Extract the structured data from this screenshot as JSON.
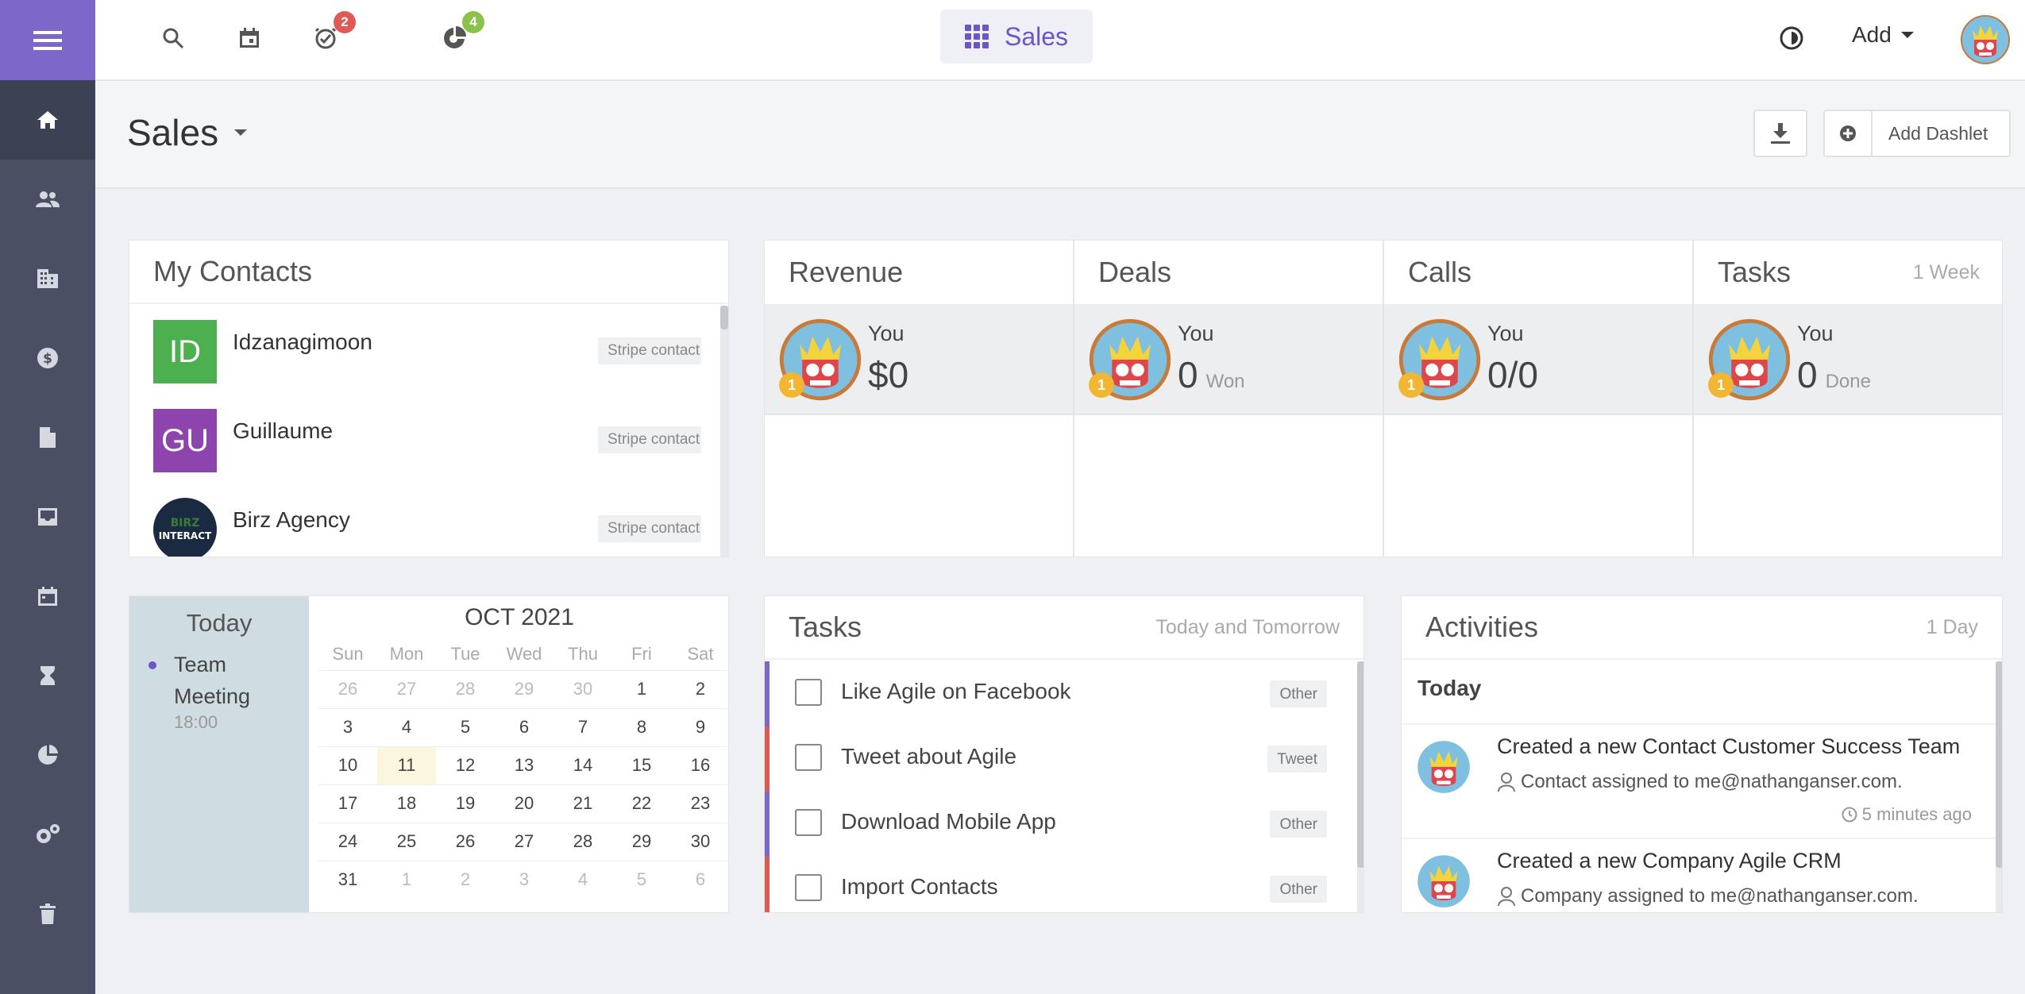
{
  "topbar": {
    "badges": {
      "tasks": "2",
      "goals": "4"
    },
    "dashboard_label": "Sales",
    "add_label": "Add"
  },
  "sidebar": {
    "items": [
      "home-icon",
      "contacts-icon",
      "companies-icon",
      "deals-icon",
      "documents-icon",
      "inbox-icon",
      "calendar-icon",
      "hourglass-icon",
      "reports-icon",
      "settings-icon",
      "trash-icon"
    ]
  },
  "page": {
    "title": "Sales",
    "add_dashlet_label": "Add Dashlet"
  },
  "contacts": {
    "title": "My Contacts",
    "items": [
      {
        "initials": "ID",
        "name": "Idzanagimoon",
        "tag": "Stripe contact",
        "color": "#4caf50"
      },
      {
        "initials": "GU",
        "name": "Guillaume",
        "tag": "Stripe contact",
        "color": "#8e44ad"
      },
      {
        "initials": "",
        "name": "Birz Agency",
        "tag": "Stripe contact",
        "color": "#1a2a40",
        "logo_text": "BIRZ INTERACT"
      }
    ]
  },
  "stats": {
    "subtitle": "1 Week",
    "rank": "1",
    "who": "You",
    "items": [
      {
        "title": "Revenue",
        "value": "$0",
        "unit": ""
      },
      {
        "title": "Deals",
        "value": "0",
        "unit": "Won"
      },
      {
        "title": "Calls",
        "value": "0/0",
        "unit": ""
      },
      {
        "title": "Tasks",
        "value": "0",
        "unit": "Done"
      }
    ]
  },
  "calendar": {
    "today_label": "Today",
    "event_title": "Team Meeting",
    "event_time": "18:00",
    "month": "OCT 2021",
    "weekdays": [
      "Sun",
      "Mon",
      "Tue",
      "Wed",
      "Thu",
      "Fri",
      "Sat"
    ],
    "weeks": [
      [
        "26",
        "27",
        "28",
        "29",
        "30",
        "1",
        "2"
      ],
      [
        "3",
        "4",
        "5",
        "6",
        "7",
        "8",
        "9"
      ],
      [
        "10",
        "11",
        "12",
        "13",
        "14",
        "15",
        "16"
      ],
      [
        "17",
        "18",
        "19",
        "20",
        "21",
        "22",
        "23"
      ],
      [
        "24",
        "25",
        "26",
        "27",
        "28",
        "29",
        "30"
      ],
      [
        "31",
        "1",
        "2",
        "3",
        "4",
        "5",
        "6"
      ]
    ],
    "today": "11"
  },
  "tasks": {
    "title": "Tasks",
    "subtitle": "Today and Tomorrow",
    "items": [
      {
        "label": "Like Agile on Facebook",
        "tag": "Other",
        "color": "#7b68c8"
      },
      {
        "label": "Tweet about Agile",
        "tag": "Tweet",
        "color": "#e05a55"
      },
      {
        "label": "Download Mobile App",
        "tag": "Other",
        "color": "#7b68c8"
      },
      {
        "label": "Import Contacts",
        "tag": "Other",
        "color": "#e05a55"
      }
    ]
  },
  "activities": {
    "title": "Activities",
    "subtitle": "1 Day",
    "group": "Today",
    "items": [
      {
        "title": "Created a new Contact Customer Success Team",
        "desc": "Contact assigned to me@nathanganser.com.",
        "time": "5 minutes ago"
      },
      {
        "title": "Created a new Company Agile CRM",
        "desc": "Company assigned to me@nathanganser.com.",
        "time": ""
      }
    ]
  }
}
